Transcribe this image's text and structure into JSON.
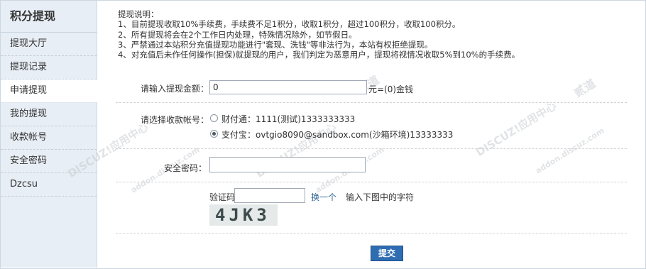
{
  "sidebar": {
    "title": "积分提现",
    "items": [
      {
        "label": "提现大厅"
      },
      {
        "label": "提现记录"
      },
      {
        "label": "申请提现",
        "active": true
      },
      {
        "label": "我的提现"
      },
      {
        "label": "收款帐号"
      },
      {
        "label": "安全密码"
      },
      {
        "label": "Dzcsu"
      }
    ]
  },
  "notes": {
    "heading": "提现说明：",
    "lines": [
      "1、目前提现收取10%手续费，手续费不足1积分，收取1积分，超过100积分，收取100积分。",
      "2、所有提现将会在2个工作日内处理，特殊情况除外，如节假日。",
      "3、严禁通过本站积分充值提现功能进行\"套现、洗钱\"等非法行为，本站有权拒绝提现。",
      "4、对充值后未作任何操作(担保)就提现的用户，我们判定为恶意用户，提现将视情况收取5%到10%的手续费。"
    ]
  },
  "form": {
    "amount_label": "请输入提现金额：",
    "amount_value": "0",
    "amount_suffix": "元=(0)金钱",
    "account_label": "请选择收款帐号：",
    "accounts": [
      {
        "label": "财付通：1111(测试)1333333333",
        "selected": false
      },
      {
        "label": "支付宝：ovtgio8090@sandbox.com(沙箱环境)13333333",
        "selected": true
      }
    ],
    "password_label": "安全密码：",
    "password_value": "",
    "captcha_label": "验证码",
    "captcha_value": "",
    "captcha_refresh": "换一个",
    "captcha_hint": "输入下图中的字符",
    "captcha_text": "4JK3",
    "submit_label": "提交"
  },
  "watermark": {
    "brand": "DISCUZ!应用中心",
    "url": "addon.discuz.com",
    "tag": "贰道"
  },
  "colors": {
    "sidebar_bg": "#e8eef5",
    "border": "#cdd6e0",
    "button": "#2f6db3",
    "link": "#336699"
  }
}
